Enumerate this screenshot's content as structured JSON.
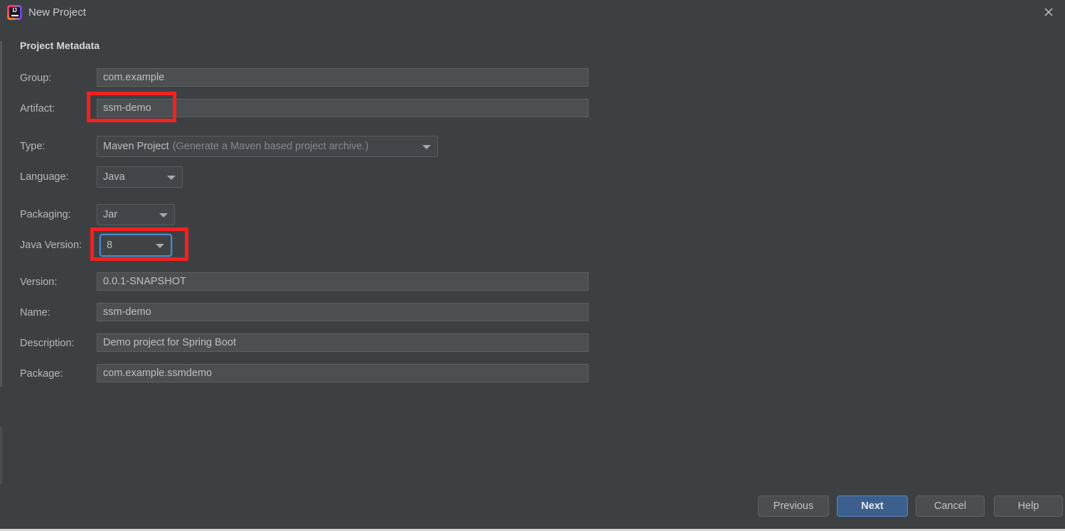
{
  "window": {
    "title": "New Project",
    "logo_icon": "intellij-idea-logo",
    "logo_text": "IJ",
    "close_icon": "close-icon"
  },
  "form": {
    "section_title": "Project Metadata",
    "fields": [
      {
        "label": "Group:",
        "value": "com.example",
        "kind": "text"
      },
      {
        "label": "Artifact:",
        "value": "ssm-demo",
        "kind": "text"
      },
      {
        "label": "Type:",
        "value": "Maven Project",
        "hint": "(Generate a Maven based project archive.)",
        "kind": "combo"
      },
      {
        "label": "Language:",
        "value": "Java",
        "kind": "combo"
      },
      {
        "label": "Packaging:",
        "value": "Jar",
        "kind": "combo"
      },
      {
        "label": "Java Version:",
        "value": "8",
        "kind": "combo"
      },
      {
        "label": "Version:",
        "value": "0.0.1-SNAPSHOT",
        "kind": "text"
      },
      {
        "label": "Name:",
        "value": "ssm-demo",
        "kind": "text"
      },
      {
        "label": "Description:",
        "value": "Demo project for Spring Boot",
        "kind": "text"
      },
      {
        "label": "Package:",
        "value": "com.example.ssmdemo",
        "kind": "text"
      }
    ]
  },
  "annotations": {
    "color": "#f52020",
    "targets": [
      "artifact-field",
      "java-version-combo"
    ]
  },
  "buttons": {
    "previous": "Previous",
    "next": "Next",
    "cancel": "Cancel",
    "help": "Help"
  },
  "colors": {
    "background": "#3c4043",
    "input_background": "#4b4f52",
    "combo_background": "#42464a",
    "text": "#bbbdbf",
    "focus_blue": "#4a88c7",
    "primary_button": "#3c5f8e",
    "annotation_red": "#f52020"
  }
}
